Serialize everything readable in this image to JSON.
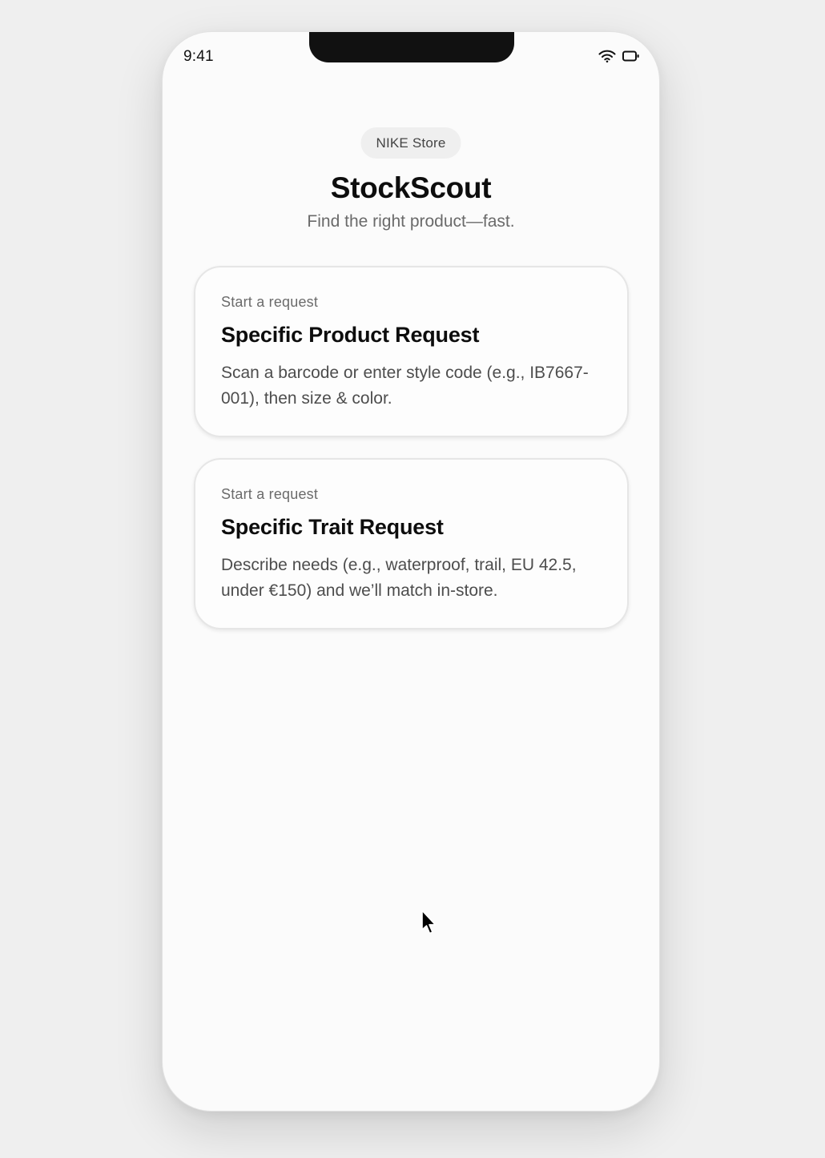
{
  "status_bar": {
    "time": "9:41",
    "icons": [
      "wifi-icon",
      "battery-icon"
    ]
  },
  "header": {
    "store_label": "NIKE Store",
    "title": "StockScout",
    "subtitle": "Find the right product—fast."
  },
  "cards": [
    {
      "eyebrow": "Start a request",
      "title": "Specific Product Request",
      "description": "Scan a barcode or enter style code (e.g., IB7667-001), then size & color."
    },
    {
      "eyebrow": "Start a request",
      "title": "Specific Trait Request",
      "description": "Describe needs (e.g., waterproof, trail, EU 42.5, under €150) and we’ll match in-store."
    }
  ],
  "colors": {
    "background": "#efefef",
    "screen": "#fbfbfb",
    "title": "#0d0d0d",
    "muted": "#6b6b6b",
    "notch": "#111111"
  }
}
